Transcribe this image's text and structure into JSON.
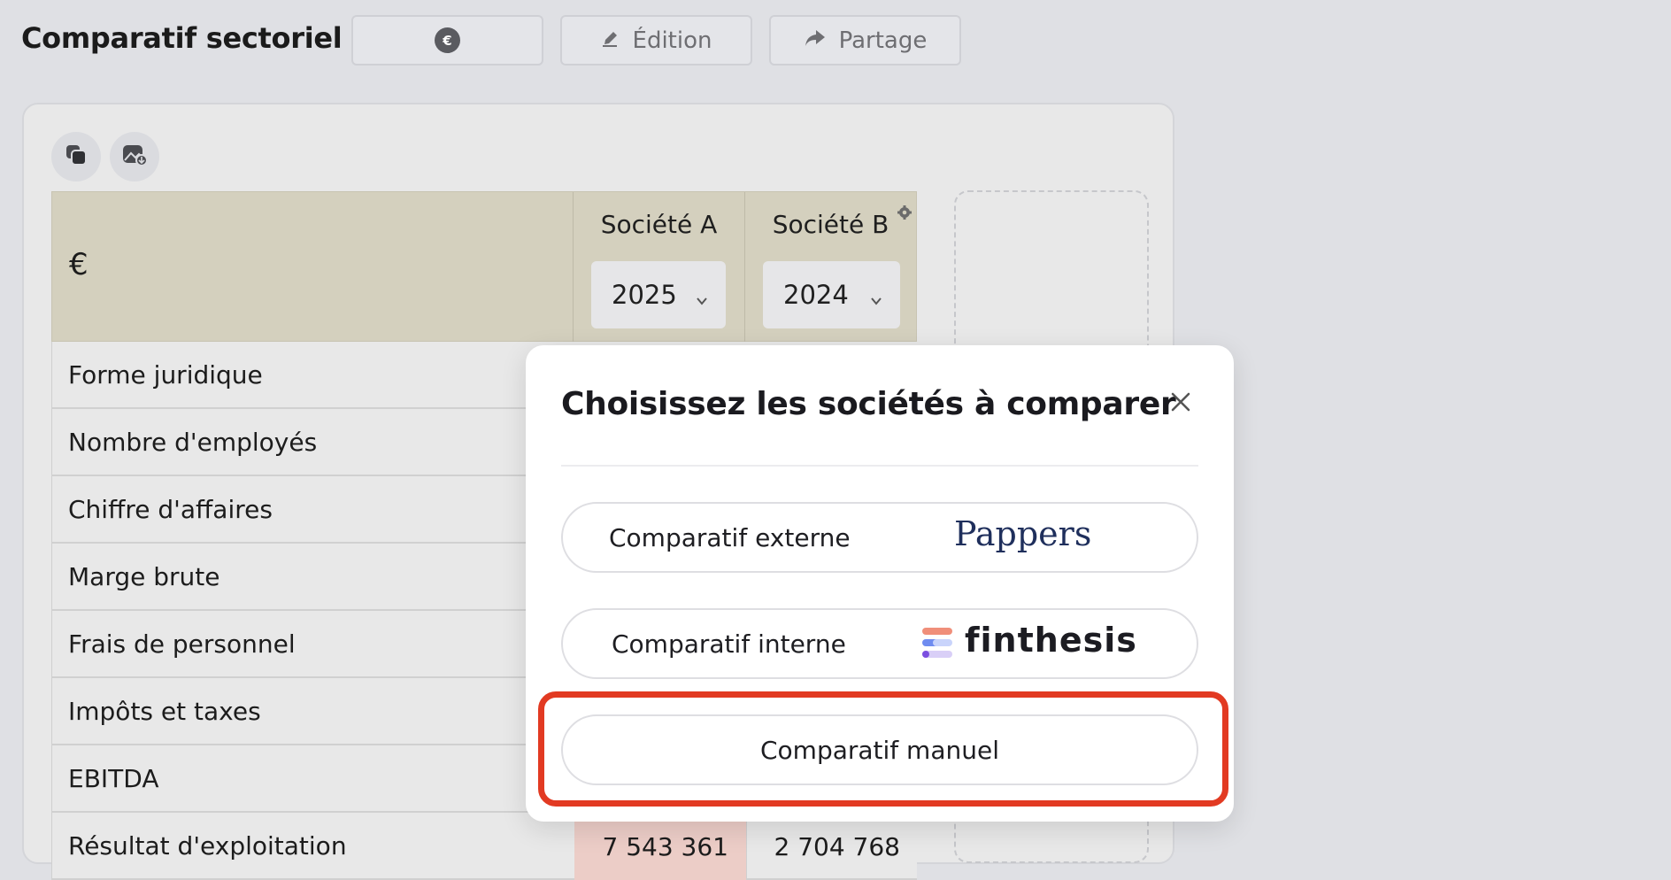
{
  "header": {
    "title": "Comparatif sectoriel",
    "currency_symbol": "€",
    "edit_label": "Édition",
    "share_label": "Partage"
  },
  "table": {
    "currency_header": "€",
    "columns": [
      {
        "name": "Société A",
        "year": "2025"
      },
      {
        "name": "Société B",
        "year": "2024"
      }
    ],
    "rows": [
      {
        "label": "Forme juridique"
      },
      {
        "label": "Nombre d'employés"
      },
      {
        "label": "Chiffre d'affaires"
      },
      {
        "label": "Marge brute"
      },
      {
        "label": "Frais de personnel"
      },
      {
        "label": "Impôts et taxes"
      },
      {
        "label": "EBITDA"
      },
      {
        "label": "Résultat d'exploitation",
        "value_a": "7 543 361",
        "value_b": "2 704 768"
      }
    ]
  },
  "modal": {
    "title": "Choisissez les sociétés à comparer",
    "options": [
      {
        "label": "Comparatif externe",
        "brand": "Pappers"
      },
      {
        "label": "Comparatif interne",
        "brand": "finthesis"
      },
      {
        "label": "Comparatif manuel"
      }
    ]
  },
  "colors": {
    "highlight": "#e23a22",
    "header_bg": "#d4d0be",
    "cell_a_bg": "#eccdc7"
  }
}
